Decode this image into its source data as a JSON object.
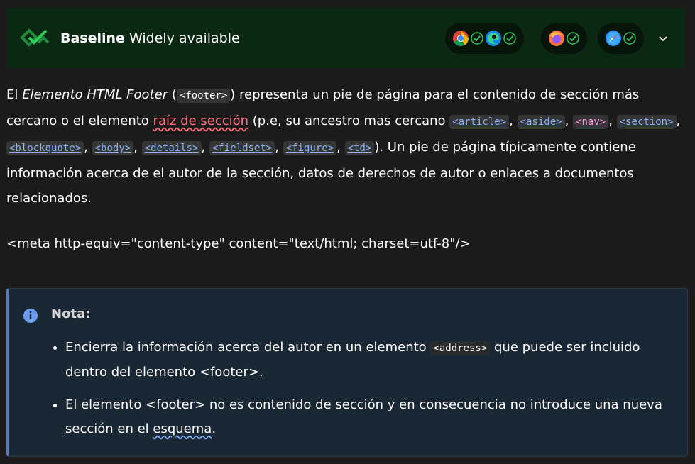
{
  "baseline": {
    "title_bold": "Baseline",
    "title_rest": " Widely available",
    "browser_groups": [
      [
        "chrome-icon",
        "edge-icon"
      ],
      [
        "firefox-icon"
      ],
      [
        "safari-icon"
      ]
    ]
  },
  "para": {
    "t1": "El ",
    "em": "Elemento HTML Footer",
    "t2": " (",
    "footer_code": "<footer>",
    "t3": ") representa un pie de página para el contenido de sección más cercano o el elemento ",
    "raiz_link": "raíz de sección",
    "t4": " (p.e, su ancestro mas cercano ",
    "article": "<article>",
    "aside": "<aside>",
    "nav": "<nav>",
    "section": "<section>",
    "blockquote": "<blockquote>",
    "body": "<body>",
    "details": "<details>",
    "fieldset": "<fieldset>",
    "figure": "<figure>",
    "td": "<td>",
    "t5": "). Un pie de página típicamente contiene información acerca de el autor de la sección, datos de derechos de autor o enlaces a documentos relacionados."
  },
  "meta_line": "<meta http-equiv=\"content-type\" content=\"text/html; charset=utf-8\"/>",
  "note": {
    "title": "Nota:",
    "li1_a": "Encierra la información acerca del autor en un elemento ",
    "li1_code": "<address>",
    "li1_b": " que puede ser incluido dentro del elemento <footer>.",
    "li2_a": "El elemento <footer> no es contenido de sección y en consecuencia no introduce una nueva sección en el ",
    "li2_link": "esquema",
    "li2_b": "."
  }
}
